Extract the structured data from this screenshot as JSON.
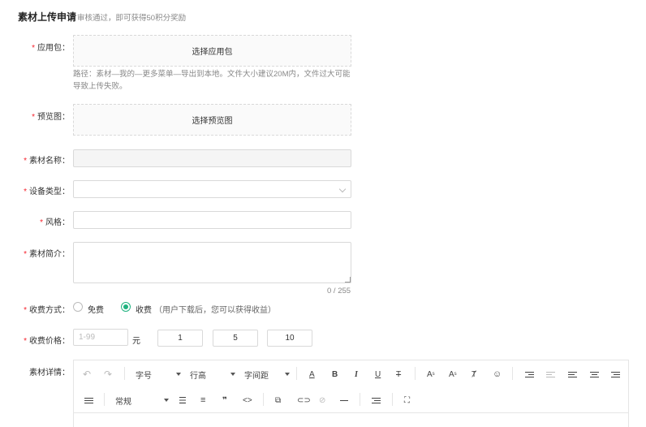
{
  "header": {
    "title": "素材上传申请",
    "subtitle": "审核通过，即可获得50积分奖励"
  },
  "fields": {
    "package": {
      "label": "应用包：",
      "button": "选择应用包",
      "hint": "路径：素材—我的—更多菜单—导出到本地。文件大小建议20M内，文件过大可能导致上传失败。"
    },
    "preview": {
      "label": "预览图：",
      "button": "选择预览图"
    },
    "name": {
      "label": "素材名称：",
      "value": ""
    },
    "device": {
      "label": "设备类型：",
      "value": ""
    },
    "style": {
      "label": "风格：",
      "value": ""
    },
    "intro": {
      "label": "素材简介：",
      "value": "",
      "counter": "0 / 255"
    },
    "charge": {
      "label": "收费方式：",
      "options": [
        "免费",
        "收费"
      ],
      "selected": "收费",
      "note": "（用户下载后，您可以获得收益）"
    },
    "price": {
      "label": "收费价格：",
      "placeholder": "1-99",
      "unit": "元",
      "presets": [
        "1",
        "5",
        "10"
      ]
    },
    "detail": {
      "label": "素材详情："
    }
  },
  "editor": {
    "font_size": "字号",
    "line_height": "行高",
    "letter_spacing": "字间距",
    "paragraph": "常规",
    "icons": [
      "undo-icon",
      "redo-icon",
      "font-color-icon",
      "bold-icon",
      "italic-icon",
      "underline-icon",
      "strikethrough-icon",
      "superscript-icon",
      "subscript-icon",
      "clear-format-icon",
      "emoji-icon",
      "indent-icon",
      "outdent-icon",
      "align-left-icon",
      "align-center-icon",
      "align-right-icon",
      "justify-icon",
      "bullet-list-icon",
      "numbered-list-icon",
      "quote-icon",
      "code-icon",
      "image-link-icon",
      "link-icon",
      "unlink-icon",
      "horizontal-rule-icon",
      "clear-icon",
      "fullscreen-icon"
    ]
  },
  "colors": {
    "accent": "#1fb27f",
    "required": "#f5222d"
  }
}
